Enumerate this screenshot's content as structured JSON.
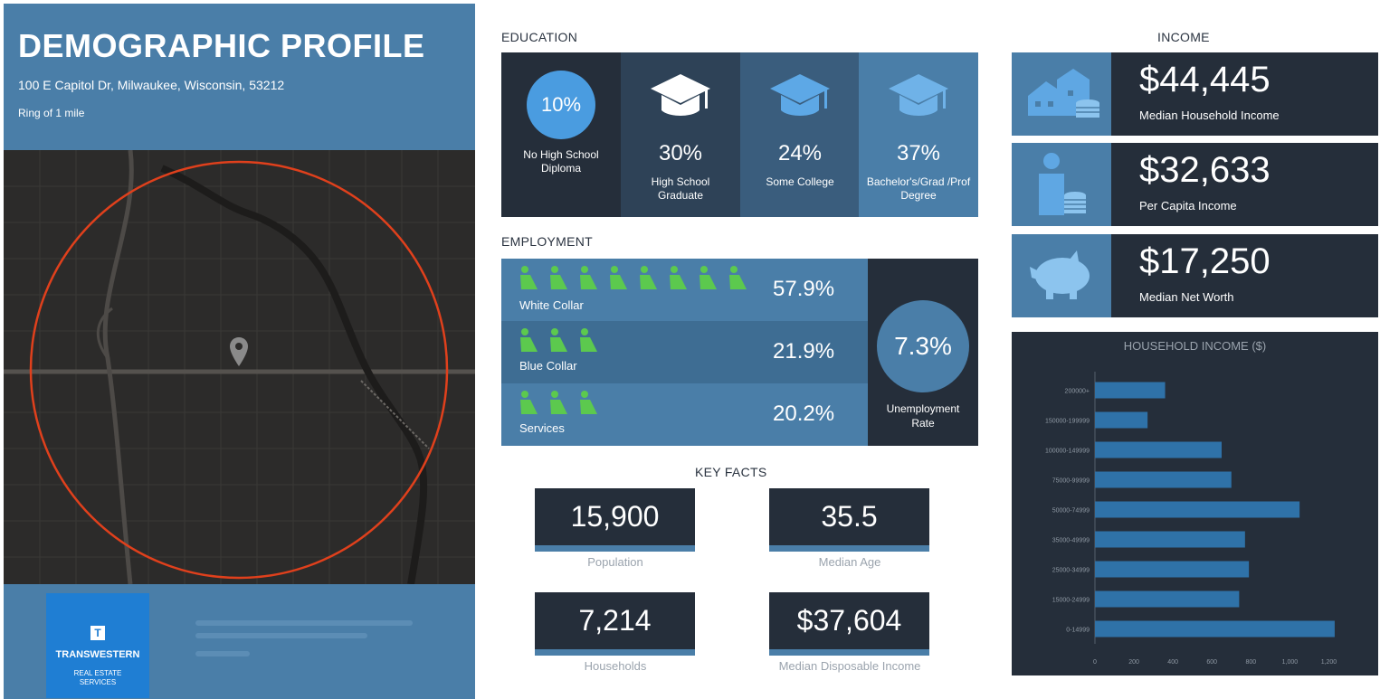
{
  "header": {
    "title": "DEMOGRAPHIC PROFILE",
    "address": "100 E Capitol Dr, Milwaukee, Wisconsin, 53212",
    "ring": "Ring of 1 mile"
  },
  "logo": {
    "brand": "TRANSWESTERN",
    "mark": "T",
    "sub_line1": "REAL ESTATE",
    "sub_line2": "SERVICES"
  },
  "education": {
    "title": "EDUCATION",
    "items": [
      {
        "pct": "10%",
        "label": "No High School Diploma"
      },
      {
        "pct": "30%",
        "label": "High School Graduate"
      },
      {
        "pct": "24%",
        "label": "Some College"
      },
      {
        "pct": "37%",
        "label": "Bachelor's/Grad /Prof Degree"
      }
    ],
    "colors": [
      "#252e3a",
      "#2e4257",
      "#3a5d7d",
      "#4a7ea8"
    ]
  },
  "employment": {
    "title": "EMPLOYMENT",
    "rows": [
      {
        "label": "White Collar",
        "pct": "57.9%",
        "icon_count": 8
      },
      {
        "label": "Blue Collar",
        "pct": "21.9%",
        "icon_count": 3
      },
      {
        "label": "Services",
        "pct": "20.2%",
        "icon_count": 3
      }
    ],
    "row_colors": [
      "#4a7ea8",
      "#3e6d93",
      "#4a7ea8"
    ],
    "icon_color": "#5cc94e",
    "unemployment": {
      "pct": "7.3%",
      "label": "Unemployment Rate"
    }
  },
  "key_facts": {
    "title": "KEY FACTS",
    "items": [
      {
        "value": "15,900",
        "label": "Population"
      },
      {
        "value": "35.5",
        "label": "Median Age"
      },
      {
        "value": "7,214",
        "label": "Households"
      },
      {
        "value": "$37,604",
        "label": "Median Disposable Income"
      }
    ]
  },
  "income": {
    "title": "INCOME",
    "items": [
      {
        "value": "$44,445",
        "label": "Median Household Income",
        "icon": "houses-coins-icon"
      },
      {
        "value": "$32,633",
        "label": "Per Capita Income",
        "icon": "person-coins-icon"
      },
      {
        "value": "$17,250",
        "label": "Median Net Worth",
        "icon": "piggy-bank-icon"
      }
    ]
  },
  "chart_data": {
    "type": "bar",
    "orientation": "horizontal",
    "title": "HOUSEHOLD INCOME ($)",
    "categories": [
      "200000+",
      "150000-199999",
      "100000-149999",
      "75000-99999",
      "50000-74999",
      "35000-49999",
      "25000-34999",
      "15000-24999",
      "0-14999"
    ],
    "values": [
      360,
      270,
      650,
      700,
      1050,
      770,
      790,
      740,
      1230
    ],
    "xlim": [
      0,
      1300
    ],
    "xticks": [
      0,
      200,
      400,
      600,
      800,
      1000,
      1200
    ],
    "bar_color": "#2f72a8",
    "grid": false
  }
}
